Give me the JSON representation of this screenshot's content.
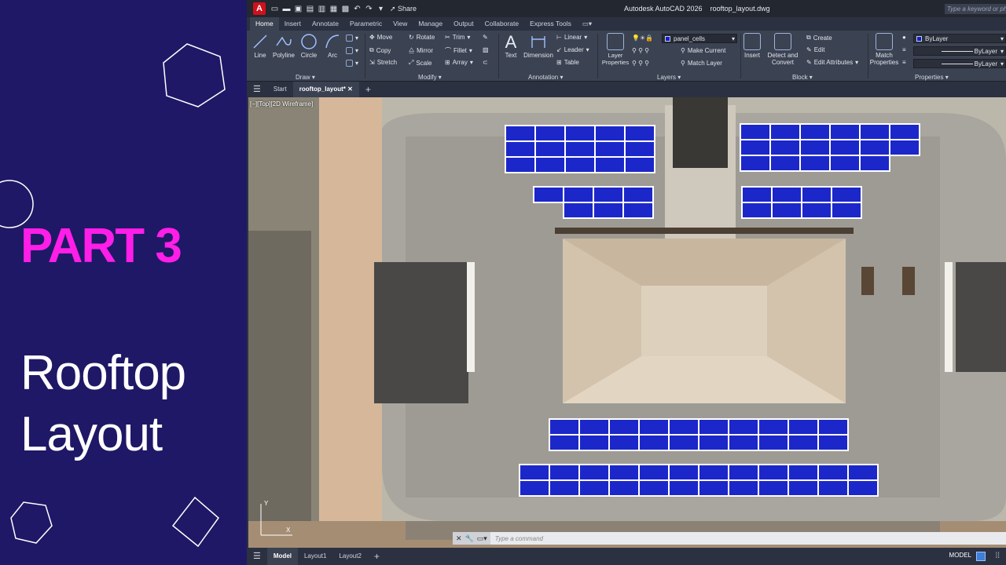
{
  "slide": {
    "part": "PART 3",
    "title_line1": "Rooftop",
    "title_line2": "Layout",
    "accent": "#ff1ee8",
    "background": "#1f1866"
  },
  "app": {
    "title": "Autodesk AutoCAD 2026",
    "filename": "rooftop_layout.dwg",
    "search_placeholder": "Type a keyword or phrase",
    "share_label": "Share",
    "logo": "A"
  },
  "ribbon_tabs": [
    "Home",
    "Insert",
    "Annotate",
    "Parametric",
    "View",
    "Manage",
    "Output",
    "Collaborate",
    "Express Tools"
  ],
  "draw": {
    "label": "Draw",
    "line": "Line",
    "polyline": "Polyline",
    "circle": "Circle",
    "arc": "Arc"
  },
  "modify": {
    "label": "Modify",
    "move": "Move",
    "rotate": "Rotate",
    "trim": "Trim",
    "copy": "Copy",
    "mirror": "Mirror",
    "fillet": "Fillet",
    "stretch": "Stretch",
    "scale": "Scale",
    "array": "Array"
  },
  "annotation": {
    "label": "Annotation",
    "text": "Text",
    "dimension": "Dimension",
    "linear": "Linear",
    "leader": "Leader",
    "table": "Table"
  },
  "layers": {
    "label": "Layers",
    "layer_properties": "Layer Properties",
    "current_layer": "panel_cells",
    "make_current": "Make Current",
    "match_layer": "Match Layer"
  },
  "block": {
    "label": "Block",
    "insert": "Insert",
    "detect": "Detect and Convert",
    "create": "Create",
    "edit": "Edit",
    "edit_attributes": "Edit Attributes"
  },
  "properties": {
    "label": "Properties",
    "match_properties": "Match Properties",
    "color": "ByLayer",
    "linetype": "ByLayer",
    "lineweight": "ByLayer"
  },
  "doc_tabs": {
    "start": "Start",
    "active": "rooftop_layout*"
  },
  "viewport_label": "[−][Top][2D Wireframe]",
  "command_placeholder": "Type a command",
  "layout_tabs": [
    "Model",
    "Layout1",
    "Layout2"
  ],
  "status": {
    "model": "MODEL"
  },
  "colors": {
    "panel_fill": "#1c27c9",
    "panel_border": "#ffffff"
  }
}
